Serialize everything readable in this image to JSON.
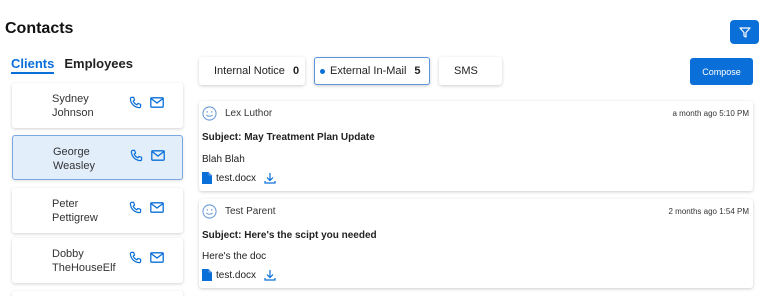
{
  "page": {
    "title": "Contacts"
  },
  "filter_button": {
    "icon": "filter-icon"
  },
  "contact_tabs": [
    {
      "label": "Clients",
      "active": true
    },
    {
      "label": "Employees",
      "active": false
    }
  ],
  "contacts": [
    {
      "name": "Sydney Johnson",
      "selected": false
    },
    {
      "name": "George Weasley",
      "selected": true
    },
    {
      "name": "Peter Pettigrew",
      "selected": false
    },
    {
      "name": "Dobby TheHouseElf",
      "selected": false
    }
  ],
  "message_tabs": [
    {
      "label": "Internal Notice",
      "count": "0",
      "active": false
    },
    {
      "label": "External In-Mail",
      "count": "5",
      "active": true
    },
    {
      "label": "SMS",
      "count": "",
      "active": false
    }
  ],
  "compose_label": "Compose",
  "messages": [
    {
      "sender": "Lex Luthor",
      "time": "a month ago 5:10 PM",
      "subject": "Subject: May Treatment Plan Update",
      "body": "Blah Blah",
      "attachment": "test.docx"
    },
    {
      "sender": "Test Parent",
      "time": "2 months ago 1:54 PM",
      "subject": "Subject: Here's the scipt you needed",
      "body": "Here's the doc",
      "attachment": "test.docx"
    }
  ],
  "colors": {
    "accent": "#0a6fd8",
    "selected_bg": "#e3eefb"
  }
}
